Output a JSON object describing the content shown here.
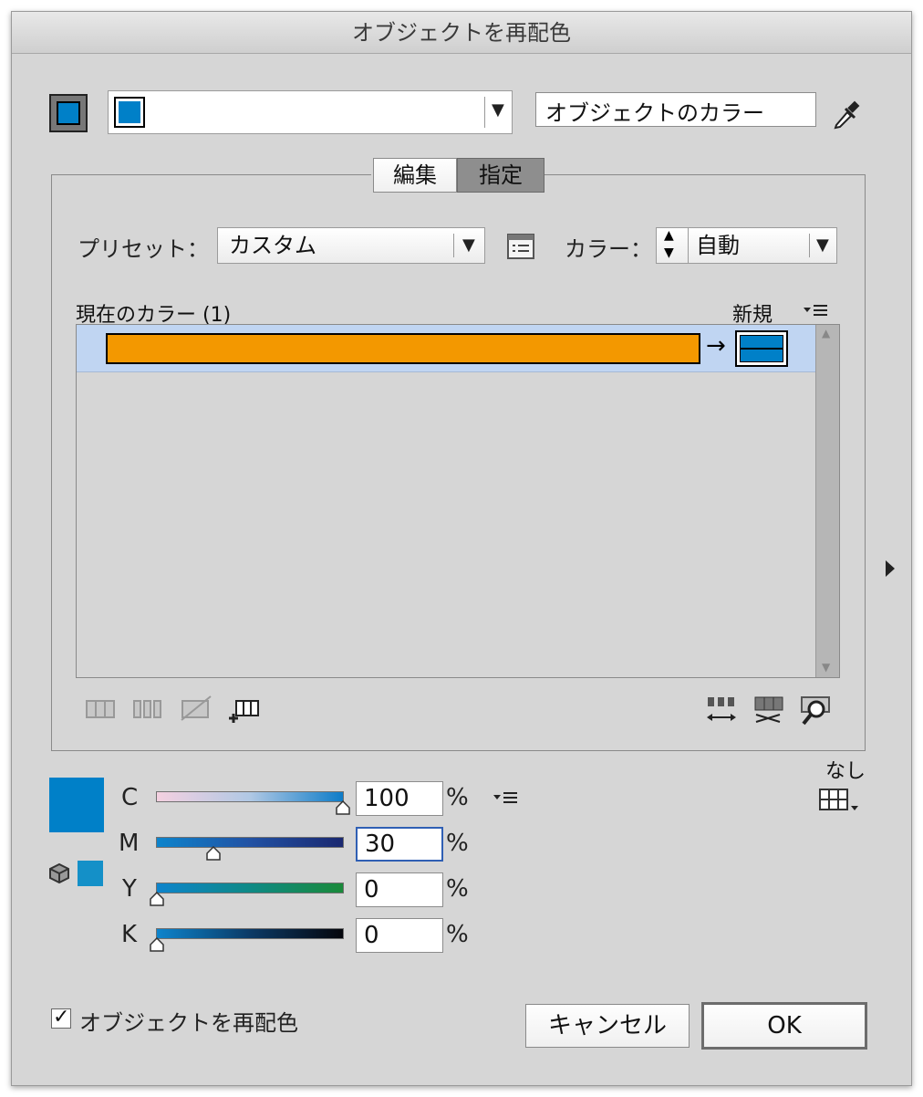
{
  "window": {
    "title": "オブジェクトを再配色"
  },
  "top": {
    "color_dropdown_value": "",
    "object_color_label": "オブジェクトのカラー"
  },
  "tabs": [
    {
      "label": "編集",
      "active": false
    },
    {
      "label": "指定",
      "active": true
    }
  ],
  "preset": {
    "label": "プリセット：",
    "value": "カスタム"
  },
  "colors": {
    "label": "カラー：",
    "value": "自動"
  },
  "list": {
    "header": "現在のカラー (1)",
    "new_label": "新規",
    "rows": [
      {
        "current": "#f39800",
        "new": "#0080c8"
      }
    ]
  },
  "cmyk": {
    "swatch": "#0080c8",
    "swatch_small": "#1490c8",
    "channels": [
      {
        "name": "C",
        "value": "100",
        "unit": "%"
      },
      {
        "name": "M",
        "value": "30",
        "unit": "%"
      },
      {
        "name": "Y",
        "value": "0",
        "unit": "%"
      },
      {
        "name": "K",
        "value": "0",
        "unit": "%"
      }
    ]
  },
  "none_label": "なし",
  "footer": {
    "recolor_checkbox_label": "オブジェクトを再配色",
    "recolor_checked": true,
    "cancel_label": "キャンセル",
    "ok_label": "OK"
  },
  "icons": [
    "color-swatch-icon",
    "eyedropper-icon",
    "preset-list-icon",
    "panel-menu-icon",
    "merge-colors-icon",
    "separate-colors-icon",
    "exclude-colors-icon",
    "new-row-icon",
    "randomize-order-icon",
    "randomize-saturation-icon",
    "find-colors-icon",
    "expand-arrow-icon",
    "gamut-cube-icon",
    "color-reduction-icon"
  ]
}
